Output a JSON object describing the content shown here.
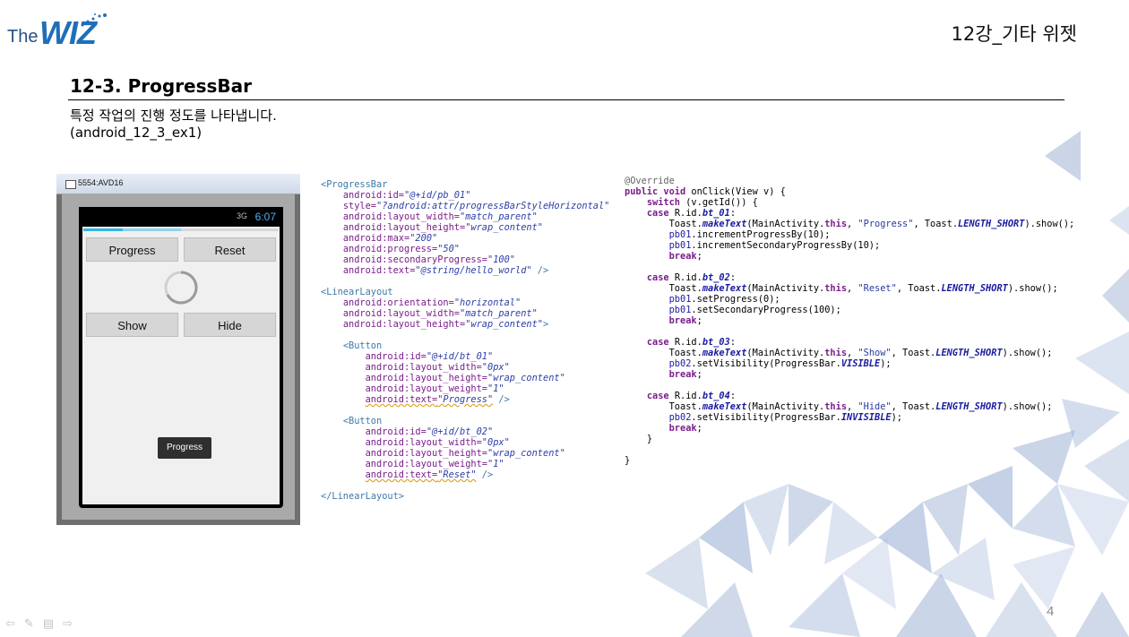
{
  "header": {
    "logo": {
      "the": "The",
      "wiz": "WIZ"
    },
    "chapter": "12강_기타 위젯"
  },
  "slide": {
    "title": "12-3. ProgressBar",
    "description": "특정 작업의 진행 정도를 나타냅니다.",
    "example": "(android_12_3_ex1)",
    "page_number": "4"
  },
  "emulator": {
    "window_title": "5554:AVD16",
    "clock": "6:07",
    "status_indicator": "3G",
    "progress": 0.2,
    "secondary_progress": 0.5,
    "buttons": {
      "progress": "Progress",
      "reset": "Reset",
      "show": "Show",
      "hide": "Hide"
    },
    "toast": "Progress"
  },
  "xml_code": [
    {
      "i": 0,
      "parts": [
        [
          "tag",
          "<ProgressBar"
        ]
      ]
    },
    {
      "i": 1,
      "parts": [
        [
          "attr",
          "android:id="
        ],
        [
          "val",
          "\"@+id/pb_01\""
        ]
      ]
    },
    {
      "i": 1,
      "parts": [
        [
          "attr",
          "style="
        ],
        [
          "val",
          "\"?android:attr/progressBarStyleHorizontal\""
        ]
      ]
    },
    {
      "i": 1,
      "parts": [
        [
          "attr",
          "android:layout_width="
        ],
        [
          "val",
          "\"match_parent\""
        ]
      ]
    },
    {
      "i": 1,
      "parts": [
        [
          "attr",
          "android:layout_height="
        ],
        [
          "val",
          "\"wrap_content\""
        ]
      ]
    },
    {
      "i": 1,
      "parts": [
        [
          "attr",
          "android:max="
        ],
        [
          "val",
          "\"200\""
        ]
      ]
    },
    {
      "i": 1,
      "parts": [
        [
          "attr",
          "android:progress="
        ],
        [
          "val",
          "\"50\""
        ]
      ]
    },
    {
      "i": 1,
      "parts": [
        [
          "attr",
          "android:secondaryProgress="
        ],
        [
          "val",
          "\"100\""
        ]
      ]
    },
    {
      "i": 1,
      "parts": [
        [
          "attr",
          "android:text="
        ],
        [
          "val",
          "\"@string/hello_world\""
        ],
        [
          "tag",
          " />"
        ]
      ]
    },
    {
      "i": 0,
      "parts": []
    },
    {
      "i": 0,
      "parts": [
        [
          "tag",
          "<LinearLayout"
        ]
      ]
    },
    {
      "i": 1,
      "parts": [
        [
          "attr",
          "android:orientation="
        ],
        [
          "val",
          "\"horizontal\""
        ]
      ]
    },
    {
      "i": 1,
      "parts": [
        [
          "attr",
          "android:layout_width="
        ],
        [
          "val",
          "\"match_parent\""
        ]
      ]
    },
    {
      "i": 1,
      "parts": [
        [
          "attr",
          "android:layout_height="
        ],
        [
          "val",
          "\"wrap_content\""
        ],
        [
          "tag",
          ">"
        ]
      ]
    },
    {
      "i": 0,
      "parts": []
    },
    {
      "i": 1,
      "parts": [
        [
          "tag",
          "<Button"
        ]
      ]
    },
    {
      "i": 2,
      "parts": [
        [
          "attr",
          "android:id="
        ],
        [
          "val",
          "\"@+id/bt_01\""
        ]
      ]
    },
    {
      "i": 2,
      "parts": [
        [
          "attr",
          "android:layout_width="
        ],
        [
          "val",
          "\"0px\""
        ]
      ]
    },
    {
      "i": 2,
      "parts": [
        [
          "attr",
          "android:layout_height="
        ],
        [
          "val",
          "\"wrap_content\""
        ]
      ]
    },
    {
      "i": 2,
      "parts": [
        [
          "attr",
          "android:layout_weight="
        ],
        [
          "val",
          "\"1\""
        ]
      ]
    },
    {
      "i": 2,
      "parts": [
        [
          "attrw",
          "android:text="
        ],
        [
          "valw",
          "\"Progress\""
        ],
        [
          "tag",
          " />"
        ]
      ]
    },
    {
      "i": 0,
      "parts": []
    },
    {
      "i": 1,
      "parts": [
        [
          "tag",
          "<Button"
        ]
      ]
    },
    {
      "i": 2,
      "parts": [
        [
          "attr",
          "android:id="
        ],
        [
          "val",
          "\"@+id/bt_02\""
        ]
      ]
    },
    {
      "i": 2,
      "parts": [
        [
          "attr",
          "android:layout_width="
        ],
        [
          "val",
          "\"0px\""
        ]
      ]
    },
    {
      "i": 2,
      "parts": [
        [
          "attr",
          "android:layout_height="
        ],
        [
          "val",
          "\"wrap_content\""
        ]
      ]
    },
    {
      "i": 2,
      "parts": [
        [
          "attr",
          "android:layout_weight="
        ],
        [
          "val",
          "\"1\""
        ]
      ]
    },
    {
      "i": 2,
      "parts": [
        [
          "attrw",
          "android:text="
        ],
        [
          "valw",
          "\"Reset\""
        ],
        [
          "tag",
          " />"
        ]
      ]
    },
    {
      "i": 0,
      "parts": []
    },
    {
      "i": 0,
      "parts": [
        [
          "tag",
          "</LinearLayout>"
        ]
      ]
    }
  ],
  "java_code": [
    {
      "i": 0,
      "parts": [
        [
          "ann",
          "@Override"
        ]
      ]
    },
    {
      "i": 0,
      "parts": [
        [
          "kw",
          "public void "
        ],
        [
          "txt",
          "onClick(View v) {"
        ]
      ]
    },
    {
      "i": 1,
      "parts": [
        [
          "kw",
          "switch "
        ],
        [
          "txt",
          "(v.getId()) {"
        ]
      ]
    },
    {
      "i": 1,
      "parts": [
        [
          "kw",
          "case "
        ],
        [
          "txt",
          "R.id."
        ],
        [
          "fld",
          "bt_01"
        ],
        [
          "txt",
          ":"
        ]
      ]
    },
    {
      "i": 2,
      "parts": [
        [
          "txt",
          "Toast."
        ],
        [
          "fld",
          "makeText"
        ],
        [
          "txt",
          "(MainActivity."
        ],
        [
          "kw",
          "this"
        ],
        [
          "txt",
          ", "
        ],
        [
          "str",
          "\"Progress\""
        ],
        [
          "txt",
          ", Toast."
        ],
        [
          "fld",
          "LENGTH_SHORT"
        ],
        [
          "txt",
          ").show();"
        ]
      ]
    },
    {
      "i": 2,
      "parts": [
        [
          "pbid",
          "pb01"
        ],
        [
          "txt",
          ".incrementProgressBy(10);"
        ]
      ]
    },
    {
      "i": 2,
      "parts": [
        [
          "pbid",
          "pb01"
        ],
        [
          "txt",
          ".incrementSecondaryProgressBy(10);"
        ]
      ]
    },
    {
      "i": 2,
      "parts": [
        [
          "kw",
          "break"
        ],
        [
          "txt",
          ";"
        ]
      ]
    },
    {
      "i": 0,
      "parts": []
    },
    {
      "i": 1,
      "parts": [
        [
          "kw",
          "case "
        ],
        [
          "txt",
          "R.id."
        ],
        [
          "fld",
          "bt_02"
        ],
        [
          "txt",
          ":"
        ]
      ]
    },
    {
      "i": 2,
      "parts": [
        [
          "txt",
          "Toast."
        ],
        [
          "fld",
          "makeText"
        ],
        [
          "txt",
          "(MainActivity."
        ],
        [
          "kw",
          "this"
        ],
        [
          "txt",
          ", "
        ],
        [
          "str",
          "\"Reset\""
        ],
        [
          "txt",
          ", Toast."
        ],
        [
          "fld",
          "LENGTH_SHORT"
        ],
        [
          "txt",
          ").show();"
        ]
      ]
    },
    {
      "i": 2,
      "parts": [
        [
          "pbid",
          "pb01"
        ],
        [
          "txt",
          ".setProgress(0);"
        ]
      ]
    },
    {
      "i": 2,
      "parts": [
        [
          "pbid",
          "pb01"
        ],
        [
          "txt",
          ".setSecondaryProgress(100);"
        ]
      ]
    },
    {
      "i": 2,
      "parts": [
        [
          "kw",
          "break"
        ],
        [
          "txt",
          ";"
        ]
      ]
    },
    {
      "i": 0,
      "parts": []
    },
    {
      "i": 1,
      "parts": [
        [
          "kw",
          "case "
        ],
        [
          "txt",
          "R.id."
        ],
        [
          "fld",
          "bt_03"
        ],
        [
          "txt",
          ":"
        ]
      ]
    },
    {
      "i": 2,
      "parts": [
        [
          "txt",
          "Toast."
        ],
        [
          "fld",
          "makeText"
        ],
        [
          "txt",
          "(MainActivity."
        ],
        [
          "kw",
          "this"
        ],
        [
          "txt",
          ", "
        ],
        [
          "str",
          "\"Show\""
        ],
        [
          "txt",
          ", Toast."
        ],
        [
          "fld",
          "LENGTH_SHORT"
        ],
        [
          "txt",
          ").show();"
        ]
      ]
    },
    {
      "i": 2,
      "parts": [
        [
          "pbid",
          "pb02"
        ],
        [
          "txt",
          ".setVisibility(ProgressBar."
        ],
        [
          "fld",
          "VISIBLE"
        ],
        [
          "txt",
          ");"
        ]
      ]
    },
    {
      "i": 2,
      "parts": [
        [
          "kw",
          "break"
        ],
        [
          "txt",
          ";"
        ]
      ]
    },
    {
      "i": 0,
      "parts": []
    },
    {
      "i": 1,
      "parts": [
        [
          "kw",
          "case "
        ],
        [
          "txt",
          "R.id."
        ],
        [
          "fld",
          "bt_04"
        ],
        [
          "txt",
          ":"
        ]
      ]
    },
    {
      "i": 2,
      "parts": [
        [
          "txt",
          "Toast."
        ],
        [
          "fld",
          "makeText"
        ],
        [
          "txt",
          "(MainActivity."
        ],
        [
          "kw",
          "this"
        ],
        [
          "txt",
          ", "
        ],
        [
          "str",
          "\"Hide\""
        ],
        [
          "txt",
          ", Toast."
        ],
        [
          "fld",
          "LENGTH_SHORT"
        ],
        [
          "txt",
          ").show();"
        ]
      ]
    },
    {
      "i": 2,
      "parts": [
        [
          "pbid",
          "pb02"
        ],
        [
          "txt",
          ".setVisibility(ProgressBar."
        ],
        [
          "fld",
          "INVISIBLE"
        ],
        [
          "txt",
          ");"
        ]
      ]
    },
    {
      "i": 2,
      "parts": [
        [
          "kw",
          "break"
        ],
        [
          "txt",
          ";"
        ]
      ]
    },
    {
      "i": 1,
      "parts": [
        [
          "txt",
          "}"
        ]
      ]
    },
    {
      "i": 0,
      "parts": []
    },
    {
      "i": 0,
      "parts": [
        [
          "txt",
          "}"
        ]
      ]
    }
  ],
  "colors": {
    "logo_blue": "#1f6fb8",
    "progress_blue": "#33b5e5",
    "deco_blue": "#9fb3d6"
  }
}
